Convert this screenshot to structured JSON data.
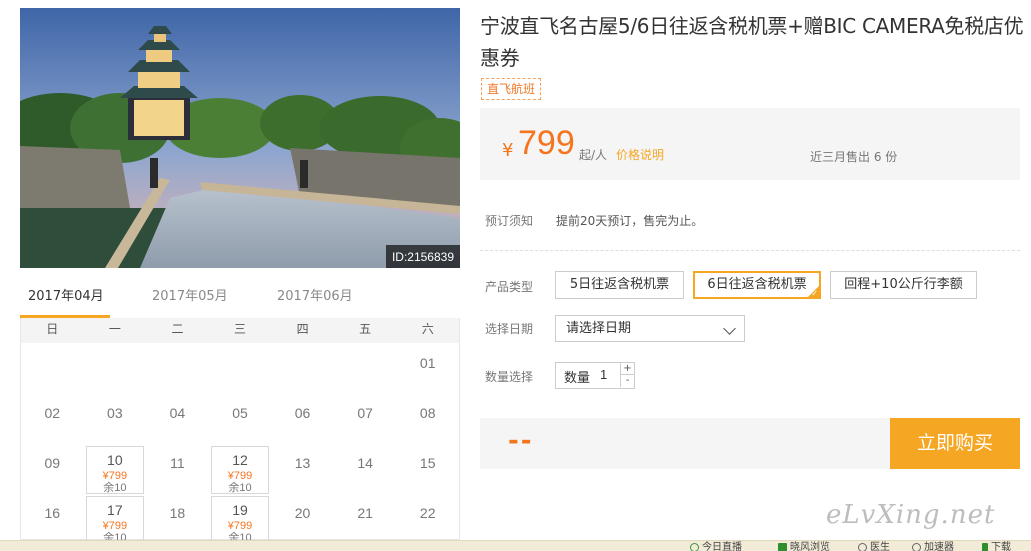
{
  "product": {
    "image_id": "ID:2156839",
    "title": "宁波直飞名古屋5/6日往返含税机票+赠BIC CAMERA免税店优惠券",
    "tag": "直飞航班",
    "currency": "¥",
    "price": "799",
    "price_unit": "起/人",
    "price_note": "价格说明",
    "sold": "近三月售出 6 份"
  },
  "booking": {
    "notice_label": "预订须知",
    "notice_text": "提前20天预订，售完为止。",
    "type_label": "产品类型",
    "options": [
      "5日往返含税机票",
      "6日往返含税机票",
      "回程+10公斤行李额"
    ],
    "selected_option": 1,
    "date_label": "选择日期",
    "date_placeholder": "请选择日期",
    "qty_label": "数量选择",
    "qty_inner_label": "数量",
    "qty_value": "1",
    "qty_up": "+",
    "qty_down": "-",
    "total": "--",
    "buy_button": "立即购买"
  },
  "calendar": {
    "months": [
      "2017年04月",
      "2017年05月",
      "2017年06月"
    ],
    "active_month": 0,
    "weekdays": [
      "日",
      "一",
      "二",
      "三",
      "四",
      "五",
      "六"
    ],
    "days": [
      {
        "day": "01",
        "col": 6,
        "row": 0
      },
      {
        "day": "02",
        "col": 0,
        "row": 1
      },
      {
        "day": "03",
        "col": 1,
        "row": 1
      },
      {
        "day": "04",
        "col": 2,
        "row": 1
      },
      {
        "day": "05",
        "col": 3,
        "row": 1
      },
      {
        "day": "06",
        "col": 4,
        "row": 1
      },
      {
        "day": "07",
        "col": 5,
        "row": 1
      },
      {
        "day": "08",
        "col": 6,
        "row": 1
      },
      {
        "day": "09",
        "col": 0,
        "row": 2
      },
      {
        "day": "10",
        "col": 1,
        "row": 2,
        "price": "¥799",
        "stock": "余10"
      },
      {
        "day": "11",
        "col": 2,
        "row": 2
      },
      {
        "day": "12",
        "col": 3,
        "row": 2,
        "price": "¥799",
        "stock": "余10"
      },
      {
        "day": "13",
        "col": 4,
        "row": 2
      },
      {
        "day": "14",
        "col": 5,
        "row": 2
      },
      {
        "day": "15",
        "col": 6,
        "row": 2
      },
      {
        "day": "16",
        "col": 0,
        "row": 3
      },
      {
        "day": "17",
        "col": 1,
        "row": 3,
        "price": "¥799",
        "stock": "余10"
      },
      {
        "day": "18",
        "col": 2,
        "row": 3
      },
      {
        "day": "19",
        "col": 3,
        "row": 3,
        "price": "¥799",
        "stock": "余10"
      },
      {
        "day": "20",
        "col": 4,
        "row": 3
      },
      {
        "day": "21",
        "col": 5,
        "row": 3
      },
      {
        "day": "22",
        "col": 6,
        "row": 3
      }
    ]
  },
  "watermark": "eLvXing.net",
  "statusbar": {
    "items": [
      "今日直播",
      "晓风浏览",
      "医生",
      "加速器",
      "下载"
    ],
    "icon_colors": [
      "#3a9a3a",
      "#2f8f2f",
      "#666666",
      "#666666",
      "#2f8f2f"
    ]
  },
  "colors": {
    "accent": "#f5a623",
    "price": "#f5751f"
  }
}
